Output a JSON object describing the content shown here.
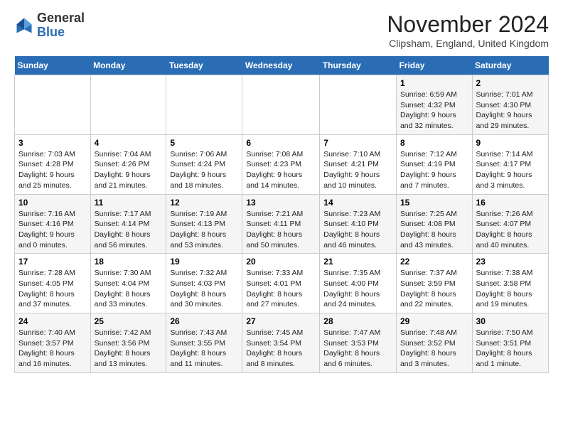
{
  "header": {
    "logo_general": "General",
    "logo_blue": "Blue",
    "month_title": "November 2024",
    "location": "Clipsham, England, United Kingdom"
  },
  "weekdays": [
    "Sunday",
    "Monday",
    "Tuesday",
    "Wednesday",
    "Thursday",
    "Friday",
    "Saturday"
  ],
  "weeks": [
    [
      {
        "day": "",
        "info": ""
      },
      {
        "day": "",
        "info": ""
      },
      {
        "day": "",
        "info": ""
      },
      {
        "day": "",
        "info": ""
      },
      {
        "day": "",
        "info": ""
      },
      {
        "day": "1",
        "info": "Sunrise: 6:59 AM\nSunset: 4:32 PM\nDaylight: 9 hours and 32 minutes."
      },
      {
        "day": "2",
        "info": "Sunrise: 7:01 AM\nSunset: 4:30 PM\nDaylight: 9 hours and 29 minutes."
      }
    ],
    [
      {
        "day": "3",
        "info": "Sunrise: 7:03 AM\nSunset: 4:28 PM\nDaylight: 9 hours and 25 minutes."
      },
      {
        "day": "4",
        "info": "Sunrise: 7:04 AM\nSunset: 4:26 PM\nDaylight: 9 hours and 21 minutes."
      },
      {
        "day": "5",
        "info": "Sunrise: 7:06 AM\nSunset: 4:24 PM\nDaylight: 9 hours and 18 minutes."
      },
      {
        "day": "6",
        "info": "Sunrise: 7:08 AM\nSunset: 4:23 PM\nDaylight: 9 hours and 14 minutes."
      },
      {
        "day": "7",
        "info": "Sunrise: 7:10 AM\nSunset: 4:21 PM\nDaylight: 9 hours and 10 minutes."
      },
      {
        "day": "8",
        "info": "Sunrise: 7:12 AM\nSunset: 4:19 PM\nDaylight: 9 hours and 7 minutes."
      },
      {
        "day": "9",
        "info": "Sunrise: 7:14 AM\nSunset: 4:17 PM\nDaylight: 9 hours and 3 minutes."
      }
    ],
    [
      {
        "day": "10",
        "info": "Sunrise: 7:16 AM\nSunset: 4:16 PM\nDaylight: 9 hours and 0 minutes."
      },
      {
        "day": "11",
        "info": "Sunrise: 7:17 AM\nSunset: 4:14 PM\nDaylight: 8 hours and 56 minutes."
      },
      {
        "day": "12",
        "info": "Sunrise: 7:19 AM\nSunset: 4:13 PM\nDaylight: 8 hours and 53 minutes."
      },
      {
        "day": "13",
        "info": "Sunrise: 7:21 AM\nSunset: 4:11 PM\nDaylight: 8 hours and 50 minutes."
      },
      {
        "day": "14",
        "info": "Sunrise: 7:23 AM\nSunset: 4:10 PM\nDaylight: 8 hours and 46 minutes."
      },
      {
        "day": "15",
        "info": "Sunrise: 7:25 AM\nSunset: 4:08 PM\nDaylight: 8 hours and 43 minutes."
      },
      {
        "day": "16",
        "info": "Sunrise: 7:26 AM\nSunset: 4:07 PM\nDaylight: 8 hours and 40 minutes."
      }
    ],
    [
      {
        "day": "17",
        "info": "Sunrise: 7:28 AM\nSunset: 4:05 PM\nDaylight: 8 hours and 37 minutes."
      },
      {
        "day": "18",
        "info": "Sunrise: 7:30 AM\nSunset: 4:04 PM\nDaylight: 8 hours and 33 minutes."
      },
      {
        "day": "19",
        "info": "Sunrise: 7:32 AM\nSunset: 4:03 PM\nDaylight: 8 hours and 30 minutes."
      },
      {
        "day": "20",
        "info": "Sunrise: 7:33 AM\nSunset: 4:01 PM\nDaylight: 8 hours and 27 minutes."
      },
      {
        "day": "21",
        "info": "Sunrise: 7:35 AM\nSunset: 4:00 PM\nDaylight: 8 hours and 24 minutes."
      },
      {
        "day": "22",
        "info": "Sunrise: 7:37 AM\nSunset: 3:59 PM\nDaylight: 8 hours and 22 minutes."
      },
      {
        "day": "23",
        "info": "Sunrise: 7:38 AM\nSunset: 3:58 PM\nDaylight: 8 hours and 19 minutes."
      }
    ],
    [
      {
        "day": "24",
        "info": "Sunrise: 7:40 AM\nSunset: 3:57 PM\nDaylight: 8 hours and 16 minutes."
      },
      {
        "day": "25",
        "info": "Sunrise: 7:42 AM\nSunset: 3:56 PM\nDaylight: 8 hours and 13 minutes."
      },
      {
        "day": "26",
        "info": "Sunrise: 7:43 AM\nSunset: 3:55 PM\nDaylight: 8 hours and 11 minutes."
      },
      {
        "day": "27",
        "info": "Sunrise: 7:45 AM\nSunset: 3:54 PM\nDaylight: 8 hours and 8 minutes."
      },
      {
        "day": "28",
        "info": "Sunrise: 7:47 AM\nSunset: 3:53 PM\nDaylight: 8 hours and 6 minutes."
      },
      {
        "day": "29",
        "info": "Sunrise: 7:48 AM\nSunset: 3:52 PM\nDaylight: 8 hours and 3 minutes."
      },
      {
        "day": "30",
        "info": "Sunrise: 7:50 AM\nSunset: 3:51 PM\nDaylight: 8 hours and 1 minute."
      }
    ]
  ]
}
